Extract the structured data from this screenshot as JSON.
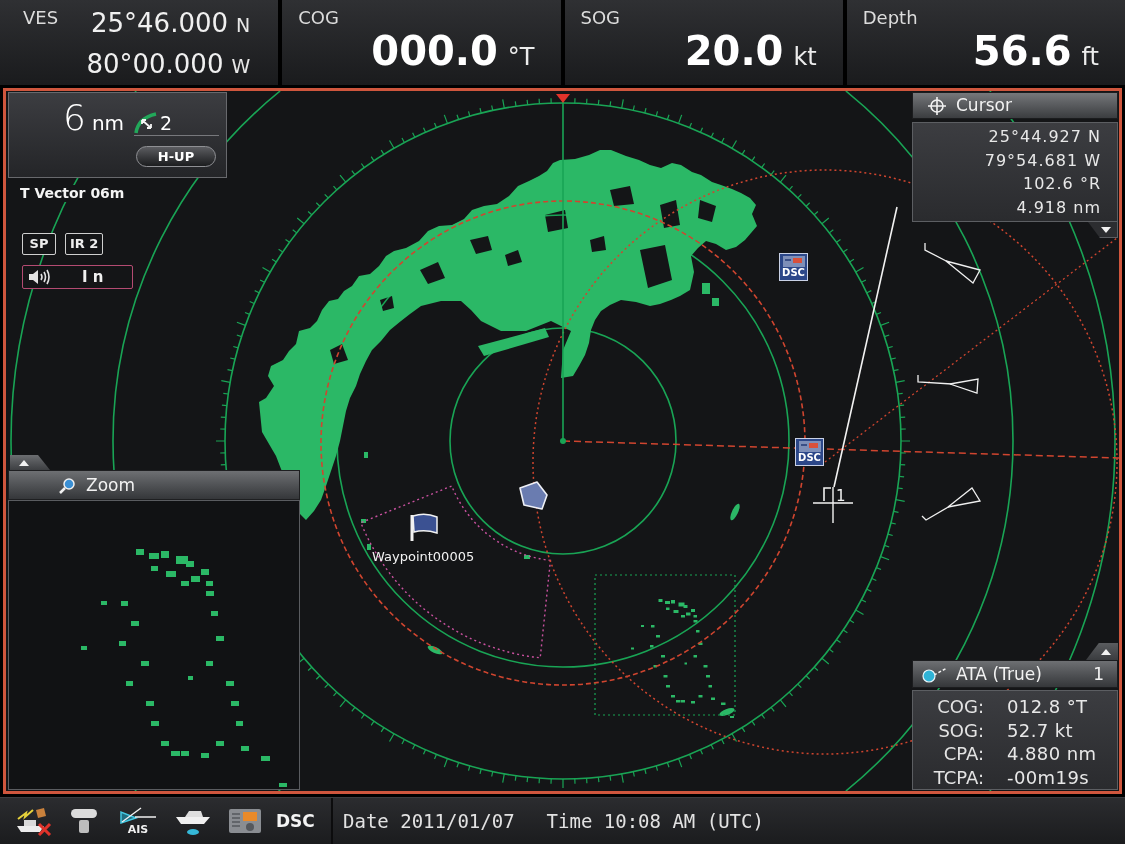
{
  "top_bar": {
    "position": {
      "label": "VES",
      "latitude": "25°46.000",
      "lat_hemisphere": "N",
      "longitude": "80°00.000",
      "lon_hemisphere": "W"
    },
    "readouts": [
      {
        "label": "COG",
        "value": "000.0",
        "unit": "°T"
      },
      {
        "label": "SOG",
        "value": "20.0",
        "unit": "kt"
      },
      {
        "label": "Depth",
        "value": "56.6",
        "unit": "ft"
      }
    ]
  },
  "range_panel": {
    "range": "6",
    "unit": "nm",
    "ring_count": "2",
    "orientation_button": "H-UP"
  },
  "vector_mode": "T Vector 06m",
  "mode_tags": [
    "SP",
    "IR 2"
  ],
  "audio_box": {
    "text": "I n"
  },
  "zoom_window": {
    "title": "Zoom"
  },
  "cursor_panel": {
    "title": "Cursor",
    "lines": [
      "25°44.927 N",
      "79°54.681 W",
      "102.6 °R",
      "4.918 nm"
    ]
  },
  "radar": {
    "waypoint_label": "Waypoint00005",
    "dsc_markers": [
      "DSC",
      "DSC"
    ],
    "target_number": "1"
  },
  "ata_panel": {
    "title": "ATA (True)",
    "count": "1",
    "rows": [
      {
        "label": "COG:",
        "value": "012.8 °T"
      },
      {
        "label": "SOG:",
        "value": "52.7 kt"
      },
      {
        "label": "CPA:",
        "value": "4.880 nm"
      },
      {
        "label": "TCPA:",
        "value": "-00m19s"
      }
    ]
  },
  "status_bar": {
    "ais_label": "AIS",
    "dsc_button": "DSC",
    "date": "Date 2011/01/07",
    "time": "Time 10:08 AM (UTC)"
  }
}
